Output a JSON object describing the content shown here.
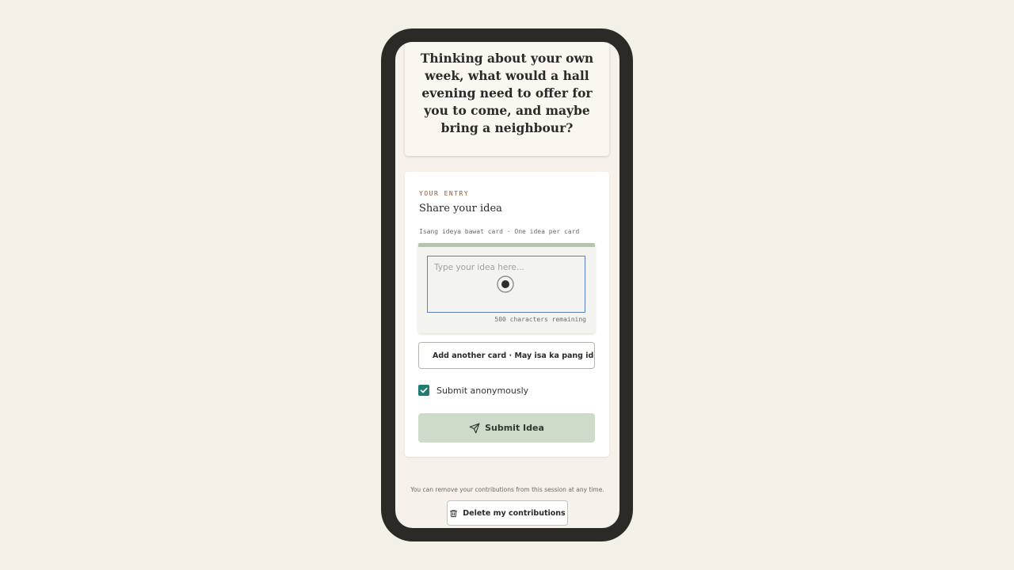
{
  "prompt": {
    "question": "Thinking about your own week, what would a hall evening need to offer for you to come, and maybe bring a neighbour?"
  },
  "entry": {
    "eyebrow": "YOUR ENTRY",
    "title": "Share your idea",
    "hint": "Isang ideya bawat card · One idea per card",
    "idea_placeholder": "Type your idea here...",
    "idea_value": "",
    "chars_remaining": "500 characters remaining",
    "add_card_label": "Add another card · May isa ka pang ideya?",
    "anonymous_label": "Submit anonymously",
    "anonymous_checked": true,
    "submit_label": "Submit Idea",
    "submit_icon": "send-icon"
  },
  "footer": {
    "note": "You can remove your contributions from this session at any time.",
    "delete_label": "Delete my contributions",
    "delete_icon": "trash-icon"
  },
  "colors": {
    "background": "#f3f0e6",
    "device_frame": "#2b2a26",
    "accent_teal": "#1f7b74",
    "submit_bg": "#cddbc8",
    "eyebrow": "#8a5a3c",
    "card_top_bar": "#b6c4ad",
    "focus_border": "#5b7fc4"
  }
}
